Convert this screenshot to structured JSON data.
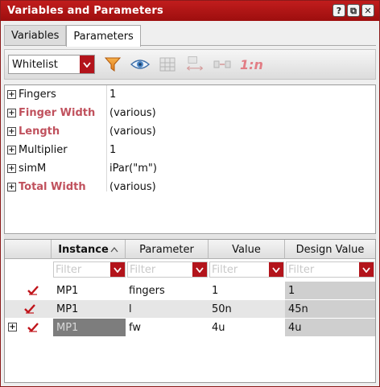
{
  "window": {
    "title": "Variables and Parameters",
    "buttons": [
      "?",
      "⧉",
      "✕"
    ]
  },
  "tabs": [
    {
      "label": "Variables",
      "active": false
    },
    {
      "label": "Parameters",
      "active": true
    }
  ],
  "toolbar": {
    "filter_combo": {
      "value": "Whitelist"
    },
    "icons": [
      "filter-icon",
      "eye-icon",
      "grid-icon",
      "resize-icon",
      "link-icon"
    ],
    "ratio_label": "1:n"
  },
  "properties": [
    {
      "name": "Fingers",
      "value": "1",
      "modified": false
    },
    {
      "name": "Finger Width",
      "value": "(various)",
      "modified": true
    },
    {
      "name": "Length",
      "value": "(various)",
      "modified": true
    },
    {
      "name": "Multiplier",
      "value": "1",
      "modified": false
    },
    {
      "name": "simM",
      "value": "iPar(\"m\")",
      "modified": false
    },
    {
      "name": "Total Width",
      "value": "(various)",
      "modified": true
    }
  ],
  "table": {
    "columns": [
      "Instance",
      "Parameter",
      "Value",
      "Design Value"
    ],
    "filter_placeholder": "Filter",
    "rows": [
      {
        "instance": "MP1",
        "parameter": "fingers",
        "value": "1",
        "design_value": "1",
        "checked": true
      },
      {
        "instance": "MP1",
        "parameter": "l",
        "value": "50n",
        "design_value": "45n",
        "checked": true
      },
      {
        "instance": "MP1",
        "parameter": "fw",
        "value": "4u",
        "design_value": "4u",
        "checked": true
      }
    ]
  },
  "colors": {
    "accent": "#b3141b",
    "modified_text": "#c0515d"
  }
}
